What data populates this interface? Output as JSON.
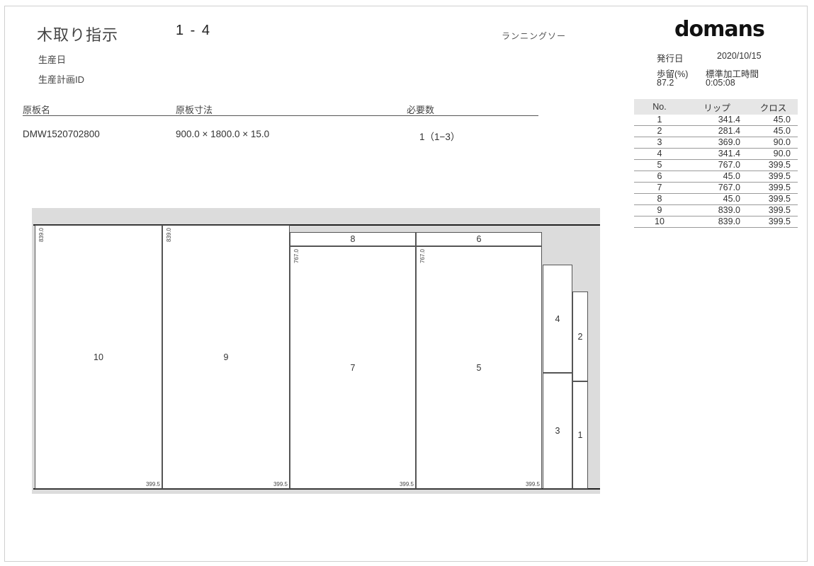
{
  "header": {
    "title": "木取り指示",
    "code": "1 - 4",
    "machine": "ランニングソー",
    "logo": "domans",
    "production_date_label": "生産日",
    "plan_id_label": "生産計画ID"
  },
  "meta": {
    "issue_date_label": "発行日",
    "issue_date": "2020/10/15",
    "yield_label": "歩留(%)",
    "yield_value": "87.2",
    "std_time_label": "標準加工時間",
    "std_time_value": "0:05:08"
  },
  "board_info": {
    "headers": [
      "原板名",
      "原板寸法",
      "必要数"
    ],
    "name": "DMW1520702800",
    "dims": "900.0 × 1800.0 × 15.0",
    "qty": "1（1−3）"
  },
  "parts_table": {
    "headers": [
      "No.",
      "リップ",
      "クロス"
    ],
    "rows": [
      {
        "no": "1",
        "rip": "341.4",
        "cross": "45.0"
      },
      {
        "no": "2",
        "rip": "281.4",
        "cross": "45.0"
      },
      {
        "no": "3",
        "rip": "369.0",
        "cross": "90.0"
      },
      {
        "no": "4",
        "rip": "341.4",
        "cross": "90.0"
      },
      {
        "no": "5",
        "rip": "767.0",
        "cross": "399.5"
      },
      {
        "no": "6",
        "rip": "45.0",
        "cross": "399.5"
      },
      {
        "no": "7",
        "rip": "767.0",
        "cross": "399.5"
      },
      {
        "no": "8",
        "rip": "45.0",
        "cross": "399.5"
      },
      {
        "no": "9",
        "rip": "839.0",
        "cross": "399.5"
      },
      {
        "no": "10",
        "rip": "839.0",
        "cross": "399.5"
      }
    ]
  },
  "layout": {
    "pieces": [
      {
        "num": "10",
        "dim_v": "839.0",
        "dim_h": "399.5"
      },
      {
        "num": "9",
        "dim_v": "839.0",
        "dim_h": "399.5"
      },
      {
        "num": "8"
      },
      {
        "num": "6"
      },
      {
        "num": "7",
        "dim_v": "767.0",
        "dim_h": "399.5"
      },
      {
        "num": "5",
        "dim_v": "767.0",
        "dim_h": "399.5"
      },
      {
        "num": "4"
      },
      {
        "num": "2"
      },
      {
        "num": "3"
      },
      {
        "num": "1"
      }
    ]
  }
}
